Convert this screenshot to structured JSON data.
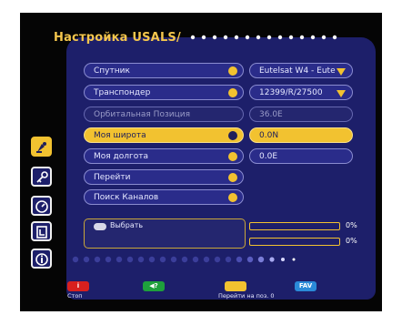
{
  "header": {
    "title": "Настройка USALS/"
  },
  "colors": {
    "accent": "#f2c230",
    "panel": "#1d1f6a",
    "selected": "#f2c230"
  },
  "menu": [
    {
      "label": "Спутник",
      "value": "Eutelsat W4 - Eute",
      "state": "normal",
      "control": "dropdown"
    },
    {
      "label": "Транспондер",
      "value": "12399/R/27500",
      "state": "normal",
      "control": "dropdown"
    },
    {
      "label": "Орбитальная Позиция",
      "value": "36.0E",
      "state": "disabled",
      "control": "readonly"
    },
    {
      "label": "Моя широта",
      "value": "0.0N",
      "state": "active",
      "control": "input"
    },
    {
      "label": "Моя долгота",
      "value": "0.0E",
      "state": "normal",
      "control": "input"
    },
    {
      "label": "Перейти",
      "state": "normal"
    },
    {
      "label": "Поиск Каналов",
      "state": "normal"
    }
  ],
  "sidebar": [
    {
      "icon": "satellite-dish-icon",
      "selected": true
    },
    {
      "icon": "key-icon",
      "selected": false
    },
    {
      "icon": "clock-icon",
      "selected": false
    },
    {
      "icon": "document-icon",
      "selected": false
    },
    {
      "icon": "info-icon",
      "selected": false
    }
  ],
  "info": {
    "icon": "ok-button-icon",
    "text": "Выбрать"
  },
  "signal": {
    "bar1_pct": "0%",
    "bar2_pct": "0%",
    "bar1_level": 0,
    "bar2_level": 0
  },
  "footer": [
    {
      "button": "i",
      "color": "#d8201e",
      "label": "Стоп"
    },
    {
      "button": "◀?",
      "color": "#1ea03c",
      "label": ""
    },
    {
      "button": "",
      "color": "#f2c230",
      "label": "Перейти на поз. 0"
    },
    {
      "button": "FAV",
      "color": "#2a8ad8",
      "label": ""
    }
  ]
}
